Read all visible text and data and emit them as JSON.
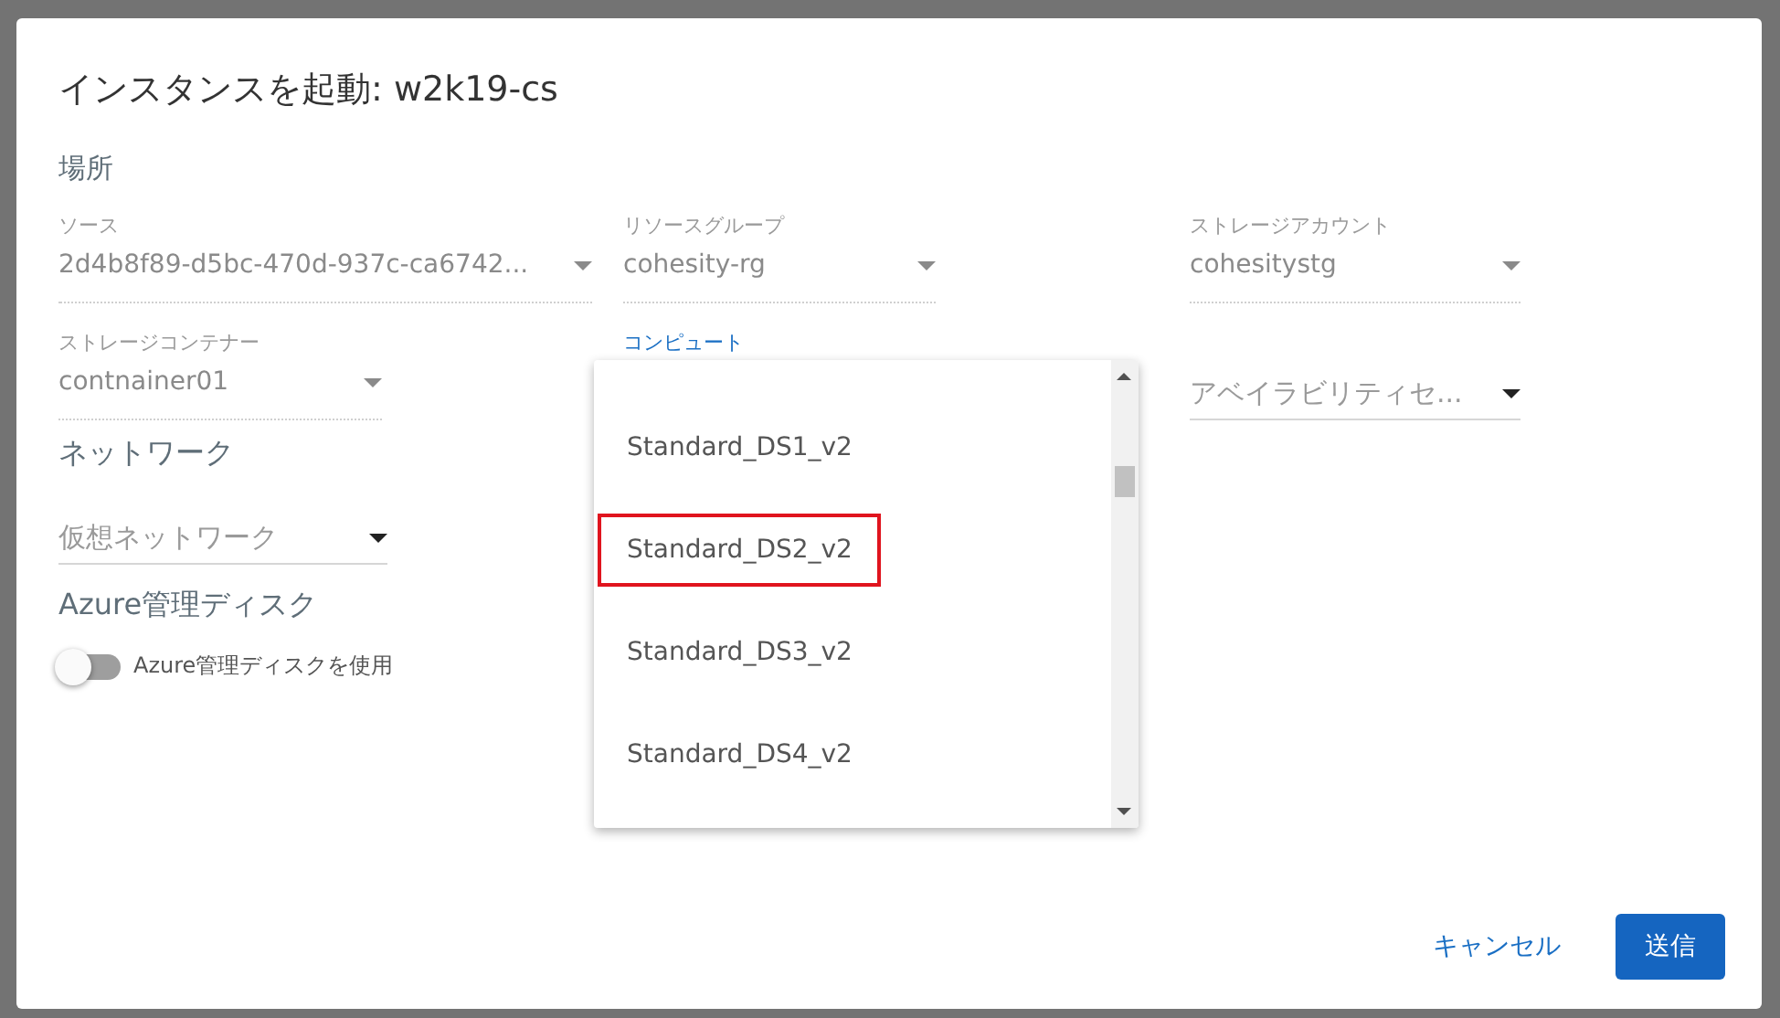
{
  "dialog": {
    "title": "インスタンスを起動: w2k19-cs",
    "location": {
      "heading": "場所",
      "fields": [
        {
          "label": "ソース",
          "value": "2d4b8f89-d5bc-470d-937c-ca6742..."
        },
        {
          "label": "リソースグループ",
          "value": "cohesity-rg"
        },
        {
          "label": "ストレージアカウント",
          "value": "cohesitystg"
        },
        {
          "label": "ストレージコンテナー",
          "value": "contnainer01"
        },
        {
          "label": "コンピュート"
        },
        {
          "placeholder": "アベイラビリティセ..."
        }
      ]
    },
    "network": {
      "heading": "ネットワーク",
      "field": {
        "placeholder": "仮想ネットワーク"
      }
    },
    "disk": {
      "heading": "Azure管理ディスク",
      "toggle": {
        "label": "Azure管理ディスクを使用",
        "on": false
      }
    },
    "dropdown": {
      "options": [
        {
          "label": "Standard_DS1_v2",
          "highlighted": false
        },
        {
          "label": "Standard_DS2_v2",
          "highlighted": true
        },
        {
          "label": "Standard_DS3_v2",
          "highlighted": false
        },
        {
          "label": "Standard_DS4_v2",
          "highlighted": false
        }
      ]
    },
    "buttons": [
      {
        "label": "キャンセル",
        "kind": "text"
      },
      {
        "label": "送信",
        "kind": "primary"
      }
    ]
  }
}
